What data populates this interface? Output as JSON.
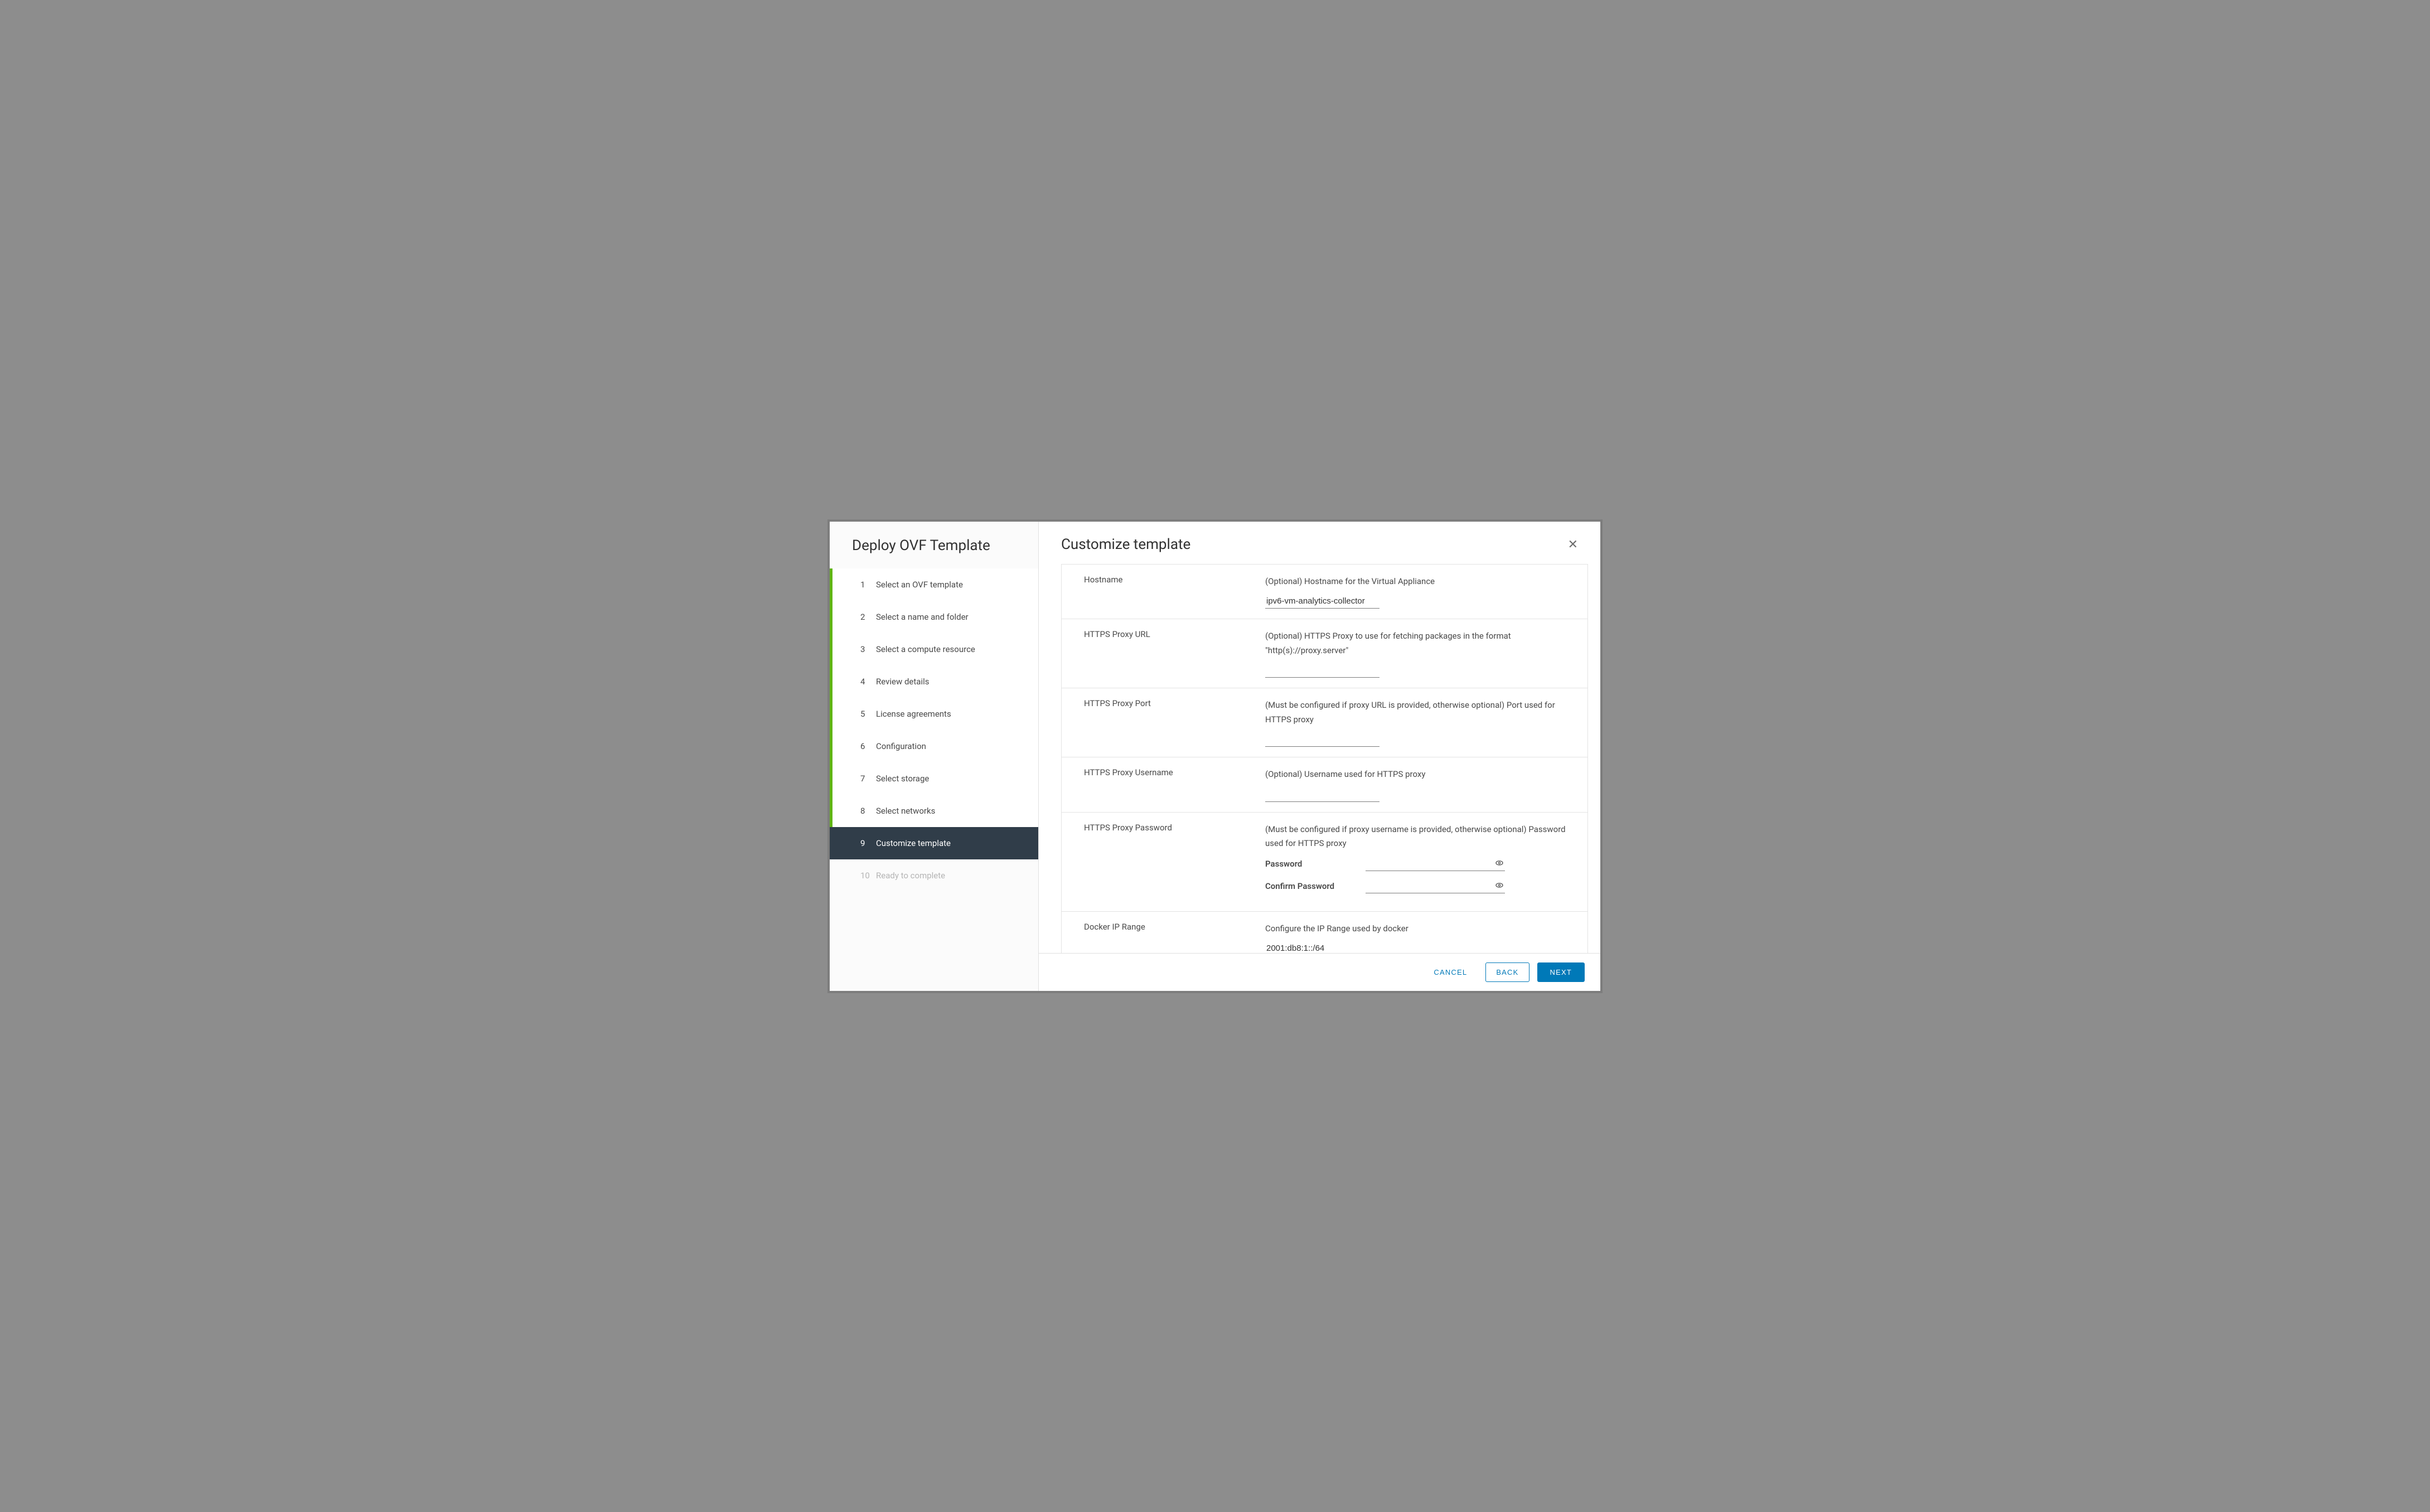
{
  "sidebar": {
    "title": "Deploy OVF Template",
    "steps": [
      {
        "num": "1",
        "label": "Select an OVF template",
        "state": "completed"
      },
      {
        "num": "2",
        "label": "Select a name and folder",
        "state": "completed"
      },
      {
        "num": "3",
        "label": "Select a compute resource",
        "state": "completed"
      },
      {
        "num": "4",
        "label": "Review details",
        "state": "completed"
      },
      {
        "num": "5",
        "label": "License agreements",
        "state": "completed"
      },
      {
        "num": "6",
        "label": "Configuration",
        "state": "completed"
      },
      {
        "num": "7",
        "label": "Select storage",
        "state": "completed"
      },
      {
        "num": "8",
        "label": "Select networks",
        "state": "completed"
      },
      {
        "num": "9",
        "label": "Customize template",
        "state": "active"
      },
      {
        "num": "10",
        "label": "Ready to complete",
        "state": "disabled"
      }
    ]
  },
  "content": {
    "title": "Customize template",
    "form": {
      "hostname": {
        "label": "Hostname",
        "desc": "(Optional) Hostname for the Virtual Appliance",
        "value": "ipv6-vm-analytics-collector"
      },
      "proxy_url": {
        "label": "HTTPS Proxy URL",
        "desc": "(Optional) HTTPS Proxy to use for fetching packages in the format \"http(s)://proxy.server\"",
        "value": ""
      },
      "proxy_port": {
        "label": "HTTPS Proxy Port",
        "desc": "(Must be configured if proxy URL is provided, otherwise optional) Port used for HTTPS proxy",
        "value": ""
      },
      "proxy_user": {
        "label": "HTTPS Proxy Username",
        "desc": "(Optional) Username used for HTTPS proxy",
        "value": ""
      },
      "proxy_pass": {
        "label": "HTTPS Proxy Password",
        "desc": "(Must be configured if proxy username is provided, otherwise optional) Password used for HTTPS proxy",
        "password_label": "Password",
        "confirm_label": "Confirm Password"
      },
      "docker_range": {
        "label": "Docker IP Range",
        "desc": "Configure the IP Range used by docker",
        "value": "2001:db8:1::/64"
      }
    }
  },
  "footer": {
    "cancel": "CANCEL",
    "back": "BACK",
    "next": "NEXT"
  }
}
